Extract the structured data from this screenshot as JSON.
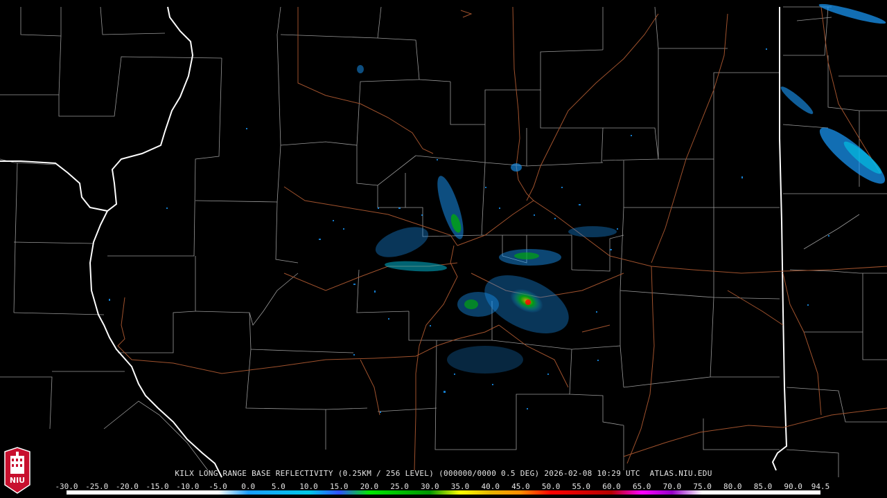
{
  "product": {
    "caption": "KILX LONG RANGE BASE REFLECTIVITY (0.25KM / 256 LEVEL) (000000/0000 0.5 DEG) 2026-02-08 10:29 UTC  ATLAS.NIU.EDU"
  },
  "colorbar": {
    "labels": [
      "-30.0",
      "-25.0",
      "-20.0",
      "-15.0",
      "-10.0",
      "-5.0",
      "0.0",
      "5.0",
      "10.0",
      "15.0",
      "20.0",
      "25.0",
      "30.0",
      "35.0",
      "40.0",
      "45.0",
      "50.0",
      "55.0",
      "60.0",
      "65.0",
      "70.0",
      "75.0",
      "80.0",
      "85.0",
      "90.0",
      "94.5"
    ],
    "stops": [
      {
        "value": -30,
        "color": "#ffffff"
      },
      {
        "value": -5,
        "color": "#ffffff"
      },
      {
        "value": 0,
        "color": "#1a9cff"
      },
      {
        "value": 10,
        "color": "#00c8e6"
      },
      {
        "value": 15,
        "color": "#3050ff"
      },
      {
        "value": 20,
        "color": "#00e600"
      },
      {
        "value": 30,
        "color": "#009600"
      },
      {
        "value": 35,
        "color": "#ffff00"
      },
      {
        "value": 40,
        "color": "#e6b400"
      },
      {
        "value": 45,
        "color": "#ff8c00"
      },
      {
        "value": 50,
        "color": "#ff0000"
      },
      {
        "value": 60,
        "color": "#b40000"
      },
      {
        "value": 65,
        "color": "#ff00ff"
      },
      {
        "value": 70,
        "color": "#9600c8"
      },
      {
        "value": 75,
        "color": "#ffffff"
      },
      {
        "value": 94.5,
        "color": "#ffffff"
      }
    ]
  },
  "map": {
    "colors": {
      "background": "#000000",
      "county_lines": "#9a9a9a",
      "state_lines": "#ffffff",
      "highways": "#a0522d"
    }
  },
  "logo": {
    "text": "NIU",
    "color": "#c8102e"
  }
}
